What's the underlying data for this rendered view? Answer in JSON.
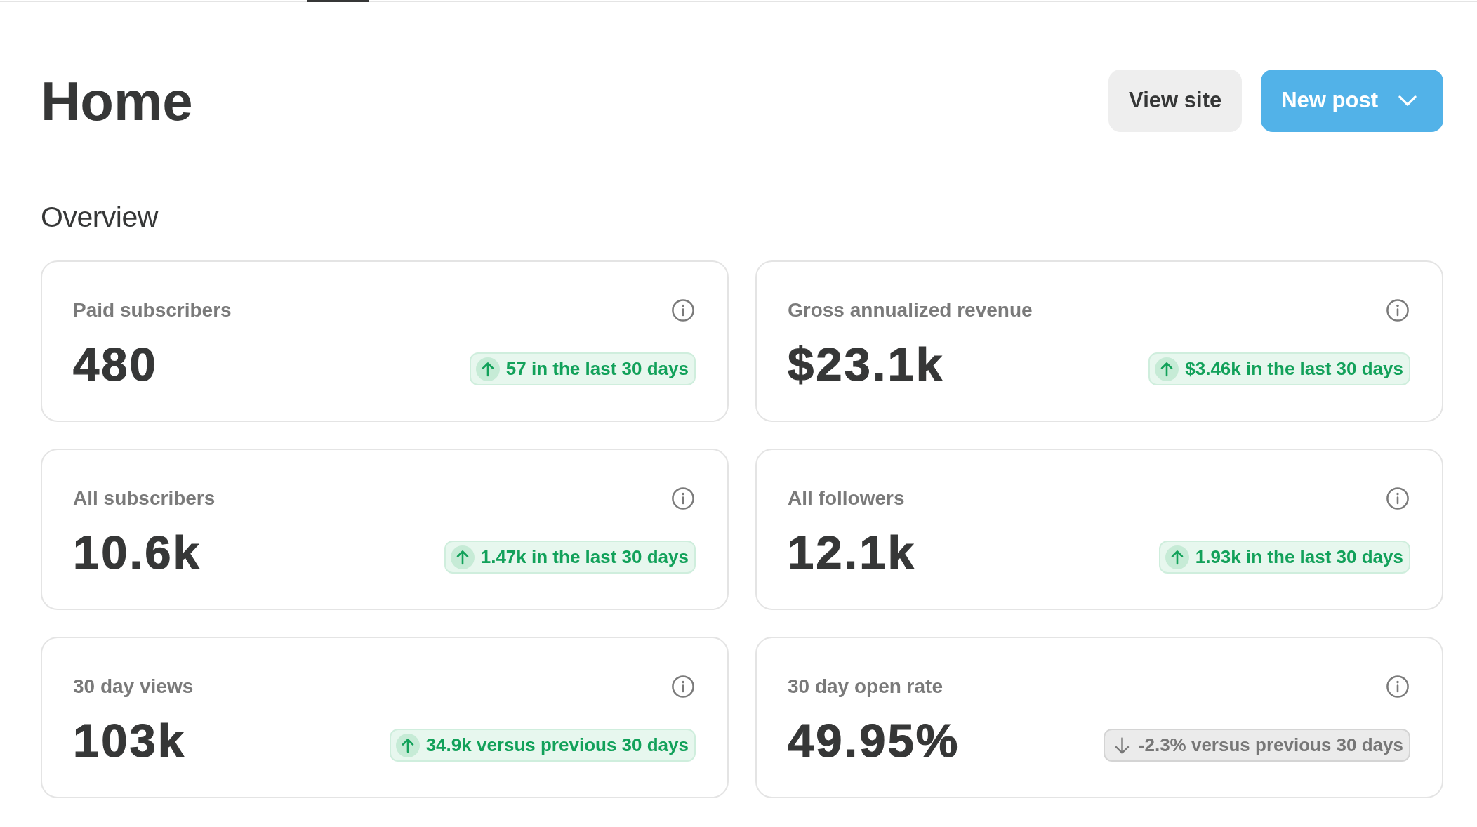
{
  "page": {
    "title": "Home"
  },
  "actions": [
    {
      "label": "View site",
      "kind": "secondary",
      "dropdown": false
    },
    {
      "label": "New post",
      "kind": "primary",
      "dropdown": true
    }
  ],
  "overview": {
    "heading": "Overview",
    "cards": [
      {
        "label": "Paid subscribers",
        "value": "480",
        "change": {
          "kind": "increase",
          "text": "57 in the last 30 days"
        }
      },
      {
        "label": "Gross annualized revenue",
        "value": "$23.1k",
        "change": {
          "kind": "increase",
          "text": "$3.46k in the last 30 days"
        }
      },
      {
        "label": "All subscribers",
        "value": "10.6k",
        "change": {
          "kind": "increase",
          "text": "1.47k in the last 30 days"
        }
      },
      {
        "label": "All followers",
        "value": "12.1k",
        "change": {
          "kind": "increase",
          "text": "1.93k in the last 30 days"
        }
      },
      {
        "label": "30 day views",
        "value": "103k",
        "change": {
          "kind": "increase",
          "text": "34.9k versus previous 30 days"
        }
      },
      {
        "label": "30 day open rate",
        "value": "49.95%",
        "change": {
          "kind": "decrease",
          "text": "-2.3% versus previous 30 days"
        }
      }
    ]
  }
}
